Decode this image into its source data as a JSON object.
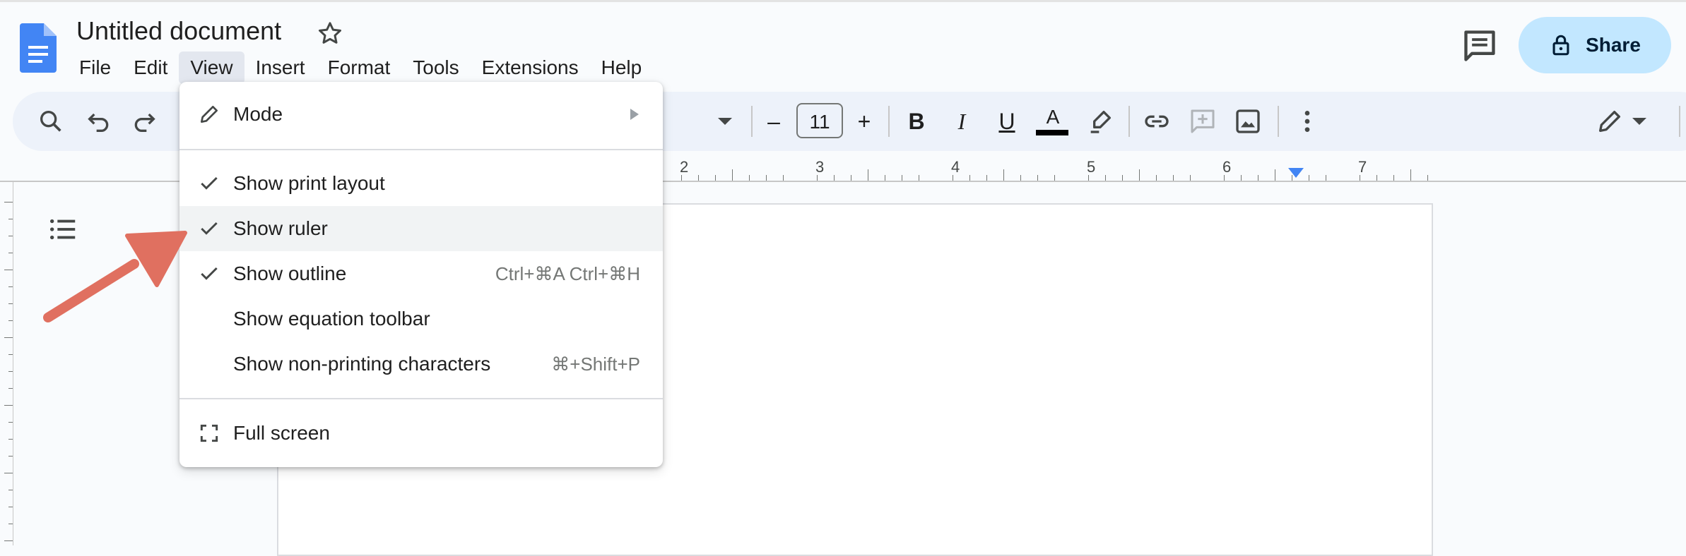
{
  "doc": {
    "title": "Untitled document"
  },
  "menubar": {
    "items": [
      "File",
      "Edit",
      "View",
      "Insert",
      "Format",
      "Tools",
      "Extensions",
      "Help"
    ],
    "active": "View"
  },
  "header": {
    "share_label": "Share"
  },
  "toolbar": {
    "font_size": "11",
    "minus": "–",
    "plus": "+",
    "bold": "B",
    "italic": "I",
    "underline": "U",
    "text_color": "A"
  },
  "ruler": {
    "numbers": [
      "2",
      "3",
      "4",
      "5",
      "6",
      "7"
    ]
  },
  "view_menu": {
    "mode_label": "Mode",
    "items": [
      {
        "label": "Show print layout",
        "checked": true,
        "shortcut": ""
      },
      {
        "label": "Show ruler",
        "checked": true,
        "shortcut": ""
      },
      {
        "label": "Show outline",
        "checked": true,
        "shortcut": "Ctrl+⌘A Ctrl+⌘H"
      },
      {
        "label": "Show equation toolbar",
        "checked": false,
        "shortcut": ""
      },
      {
        "label": "Show non-printing characters",
        "checked": false,
        "shortcut": "⌘+Shift+P"
      }
    ],
    "fullscreen_label": "Full screen"
  },
  "colors": {
    "share_bg": "#c2e7ff",
    "docs_blue": "#4285f4",
    "annotation": "#e07060",
    "ruler_marker": "#4285f4"
  }
}
